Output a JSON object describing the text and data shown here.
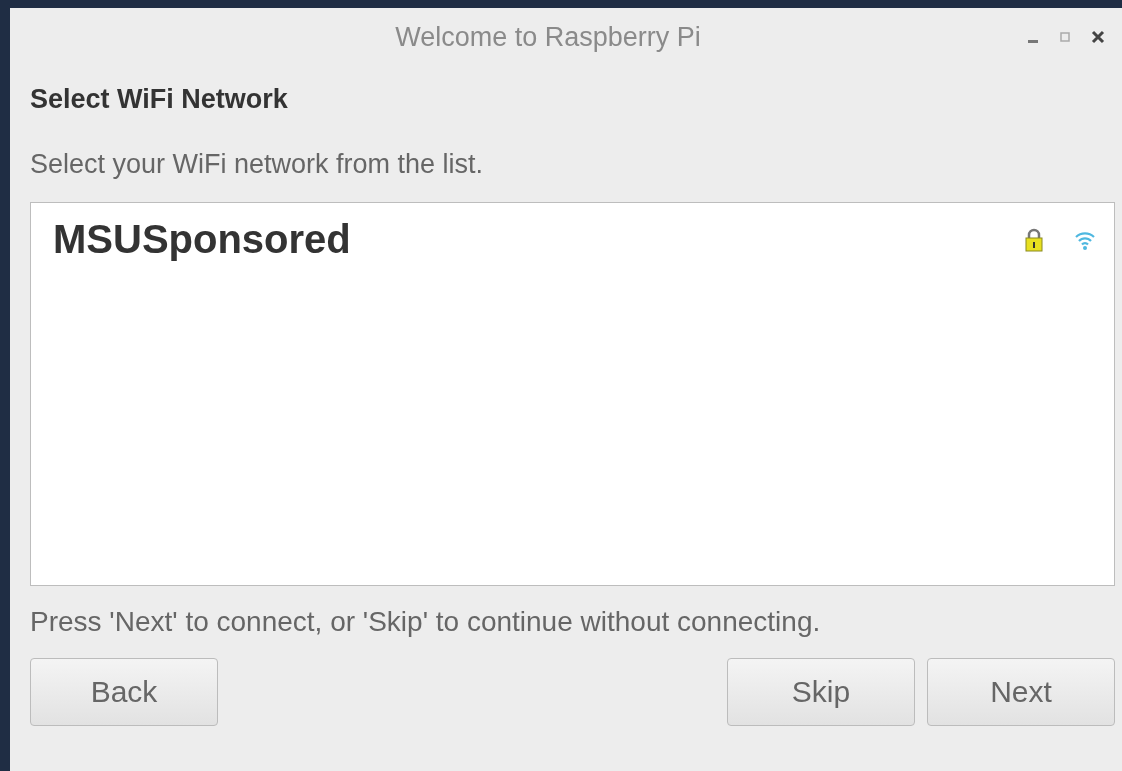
{
  "window": {
    "title": "Welcome to Raspberry Pi"
  },
  "heading": "Select WiFi Network",
  "instruction": "Select your WiFi network from the list.",
  "networks": [
    {
      "name": "MSUSponsored",
      "secured": true
    }
  ],
  "hint": "Press 'Next' to connect, or 'Skip' to continue without connecting.",
  "left_buttons": [
    "Back"
  ],
  "right_buttons": [
    "Skip",
    "Next"
  ]
}
